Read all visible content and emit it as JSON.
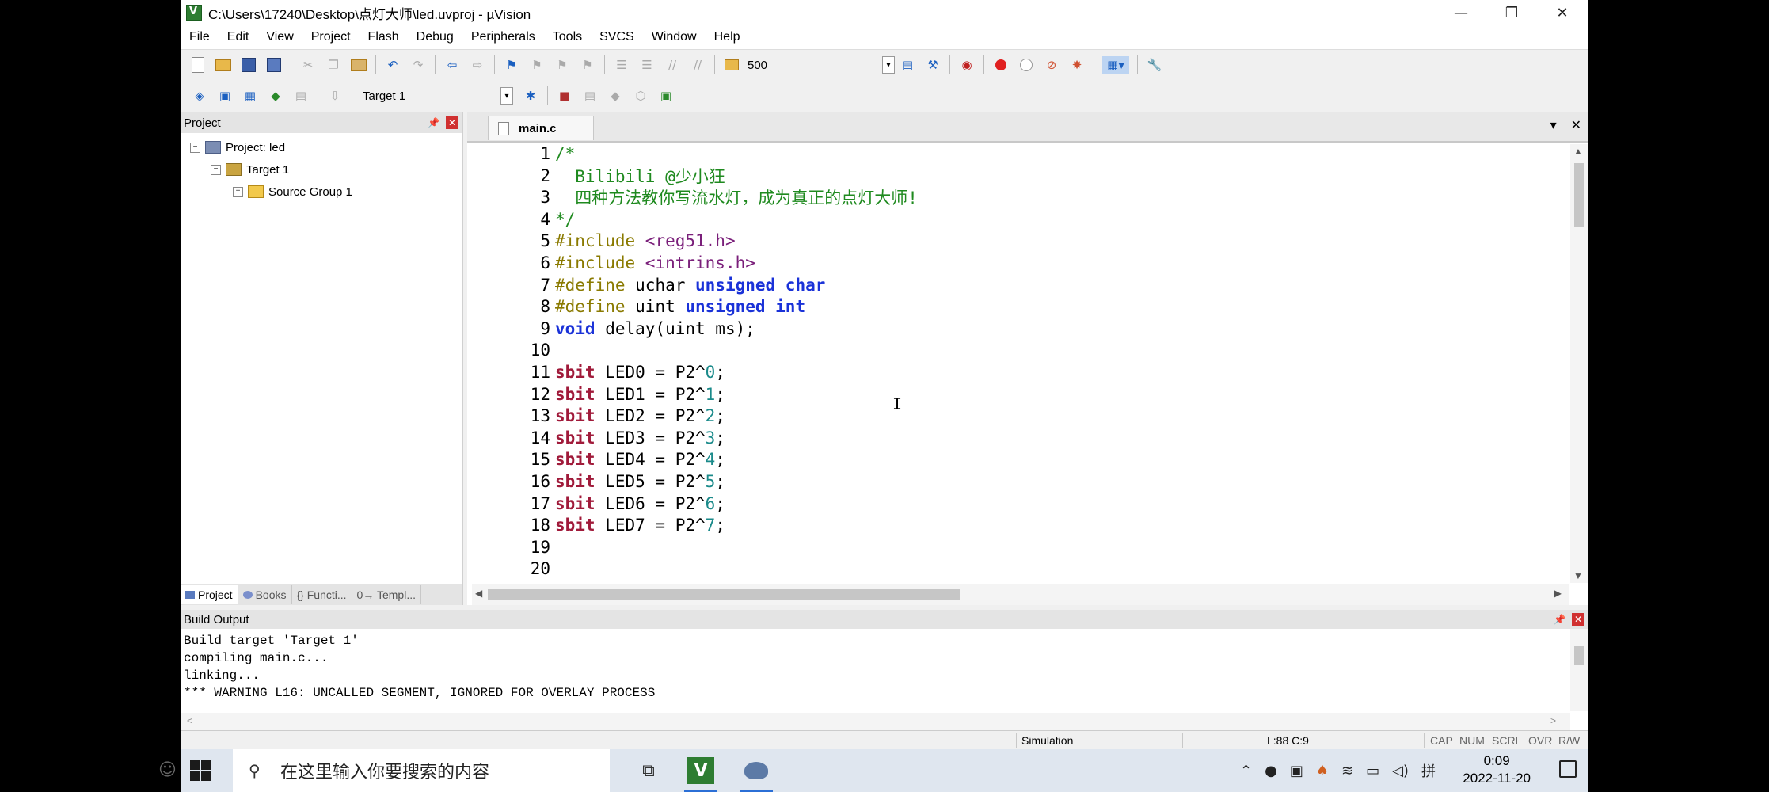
{
  "window": {
    "title": "C:\\Users\\17240\\Desktop\\点灯大师\\led.uvproj - µVision",
    "controls": {
      "minimize": "—",
      "maximize": "❐",
      "close": "✕"
    }
  },
  "menu": [
    "File",
    "Edit",
    "View",
    "Project",
    "Flash",
    "Debug",
    "Peripherals",
    "Tools",
    "SVCS",
    "Window",
    "Help"
  ],
  "toolbar1": {
    "value_field": "500"
  },
  "toolbar2": {
    "target": "Target 1"
  },
  "project_panel": {
    "title": "Project",
    "tree": {
      "project": "Project: led",
      "target": "Target 1",
      "group": "Source Group 1"
    },
    "tabs": [
      "Project",
      "Books",
      "{} Functi...",
      "0→ Templ..."
    ]
  },
  "editor": {
    "tab": "main.c",
    "lines": [
      {
        "n": "1",
        "parts": [
          {
            "t": "/*",
            "c": "com"
          }
        ]
      },
      {
        "n": "2",
        "parts": [
          {
            "t": "  Bilibili @少小狂",
            "c": "com"
          }
        ]
      },
      {
        "n": "3",
        "parts": [
          {
            "t": "  四种方法教你写流水灯，成为真正的点灯大师!",
            "c": "com"
          }
        ]
      },
      {
        "n": "4",
        "parts": [
          {
            "t": "*/",
            "c": "com"
          }
        ]
      },
      {
        "n": "5",
        "parts": [
          {
            "t": "#include ",
            "c": "pp"
          },
          {
            "t": "<reg51.h>",
            "c": "hdr"
          }
        ]
      },
      {
        "n": "6",
        "parts": [
          {
            "t": "#include ",
            "c": "pp"
          },
          {
            "t": "<intrins.h>",
            "c": "hdr"
          }
        ]
      },
      {
        "n": "7",
        "parts": [
          {
            "t": "#define ",
            "c": "pp"
          },
          {
            "t": "uchar ",
            "c": "txt"
          },
          {
            "t": "unsigned char",
            "c": "kw"
          }
        ]
      },
      {
        "n": "8",
        "parts": [
          {
            "t": "#define ",
            "c": "pp"
          },
          {
            "t": "uint ",
            "c": "txt"
          },
          {
            "t": "unsigned int",
            "c": "kw"
          }
        ]
      },
      {
        "n": "9",
        "parts": [
          {
            "t": "void",
            "c": "kw"
          },
          {
            "t": " delay(uint ms);",
            "c": "txt"
          }
        ]
      },
      {
        "n": "10",
        "parts": []
      },
      {
        "n": "11",
        "parts": [
          {
            "t": "sbit",
            "c": "sbit"
          },
          {
            "t": " LED0 = P2^",
            "c": "txt"
          },
          {
            "t": "0",
            "c": "num"
          },
          {
            "t": ";",
            "c": "txt"
          }
        ]
      },
      {
        "n": "12",
        "parts": [
          {
            "t": "sbit",
            "c": "sbit"
          },
          {
            "t": " LED1 = P2^",
            "c": "txt"
          },
          {
            "t": "1",
            "c": "num"
          },
          {
            "t": ";",
            "c": "txt"
          }
        ]
      },
      {
        "n": "13",
        "parts": [
          {
            "t": "sbit",
            "c": "sbit"
          },
          {
            "t": " LED2 = P2^",
            "c": "txt"
          },
          {
            "t": "2",
            "c": "num"
          },
          {
            "t": ";",
            "c": "txt"
          }
        ]
      },
      {
        "n": "14",
        "parts": [
          {
            "t": "sbit",
            "c": "sbit"
          },
          {
            "t": " LED3 = P2^",
            "c": "txt"
          },
          {
            "t": "3",
            "c": "num"
          },
          {
            "t": ";",
            "c": "txt"
          }
        ]
      },
      {
        "n": "15",
        "parts": [
          {
            "t": "sbit",
            "c": "sbit"
          },
          {
            "t": " LED4 = P2^",
            "c": "txt"
          },
          {
            "t": "4",
            "c": "num"
          },
          {
            "t": ";",
            "c": "txt"
          }
        ]
      },
      {
        "n": "16",
        "parts": [
          {
            "t": "sbit",
            "c": "sbit"
          },
          {
            "t": " LED5 = P2^",
            "c": "txt"
          },
          {
            "t": "5",
            "c": "num"
          },
          {
            "t": ";",
            "c": "txt"
          }
        ]
      },
      {
        "n": "17",
        "parts": [
          {
            "t": "sbit",
            "c": "sbit"
          },
          {
            "t": " LED6 = P2^",
            "c": "txt"
          },
          {
            "t": "6",
            "c": "num"
          },
          {
            "t": ";",
            "c": "txt"
          }
        ]
      },
      {
        "n": "18",
        "parts": [
          {
            "t": "sbit",
            "c": "sbit"
          },
          {
            "t": " LED7 = P2^",
            "c": "txt"
          },
          {
            "t": "7",
            "c": "num"
          },
          {
            "t": ";",
            "c": "txt"
          }
        ]
      },
      {
        "n": "19",
        "parts": []
      },
      {
        "n": "20",
        "parts": []
      }
    ],
    "colors": {
      "com": "#1f8a1f",
      "pp": "#8a7a00",
      "hdr": "#7a1f7a",
      "kw": "#1a32d8",
      "sbit": "#a01a3a",
      "num": "#1a8a8a",
      "txt": "#000000"
    }
  },
  "build_output": {
    "title": "Build Output",
    "lines": [
      "Build target 'Target 1'",
      "compiling main.c...",
      "linking...",
      "*** WARNING L16: UNCALLED SEGMENT, IGNORED FOR OVERLAY PROCESS"
    ]
  },
  "status": {
    "mode": "Simulation",
    "position": "L:88 C:9",
    "indicators": [
      "CAP",
      "NUM",
      "SCRL",
      "OVR",
      "R/W"
    ]
  },
  "taskbar": {
    "search_placeholder": "在这里输入你要搜索的内容",
    "time": "0:09",
    "date": "2022-11-20"
  }
}
